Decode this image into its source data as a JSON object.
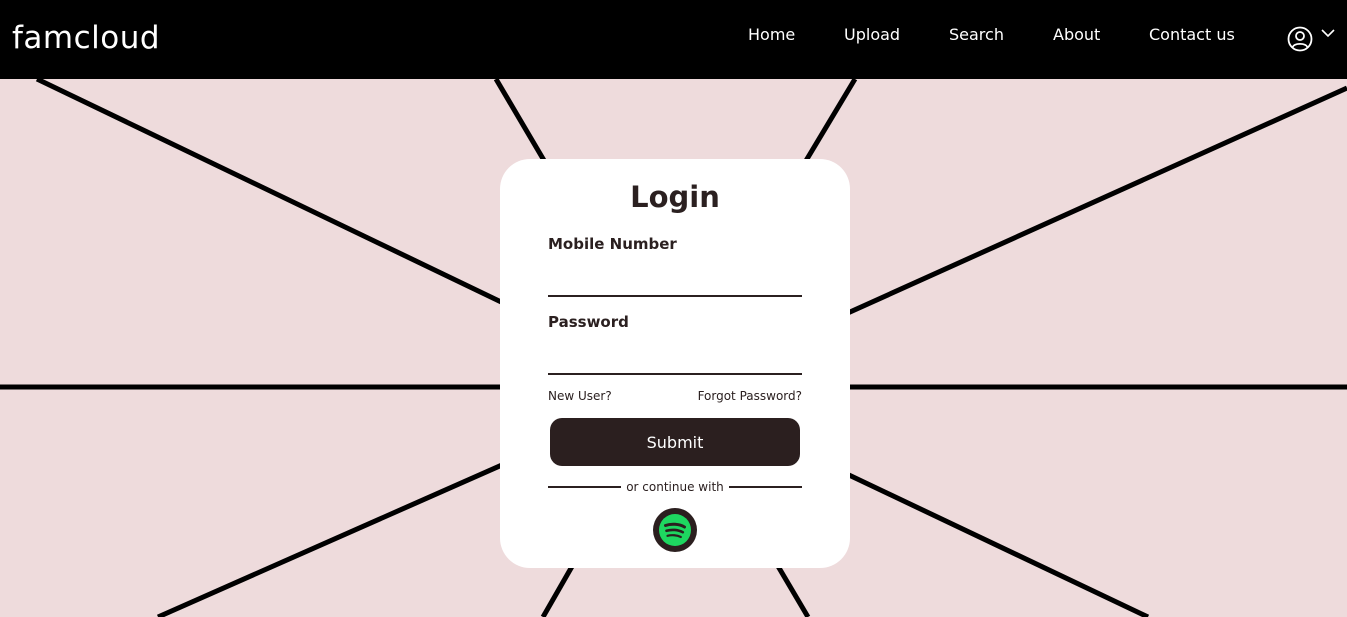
{
  "nav": {
    "brand": "famcloud",
    "links": [
      {
        "label": "Home"
      },
      {
        "label": "Upload"
      },
      {
        "label": "Search"
      },
      {
        "label": "About"
      },
      {
        "label": "Contact us"
      }
    ],
    "user_icon": "user-circle-icon",
    "dropdown_icon": "chevron-down-icon"
  },
  "login": {
    "title": "Login",
    "mobile_label": "Mobile Number",
    "mobile_value": "",
    "password_label": "Password",
    "password_value": "",
    "new_user": "New User?",
    "forgot_password": "Forgot Password?",
    "submit": "Submit",
    "continue_with": "or continue with",
    "social_icon": "spotify-icon"
  },
  "colors": {
    "navbar_bg": "#000000",
    "page_bg": "#eedbdc",
    "card_bg": "#ffffff",
    "button_bg": "#2b1f1f",
    "spotify_green": "#1ed760",
    "text_dark": "#2b2020"
  }
}
